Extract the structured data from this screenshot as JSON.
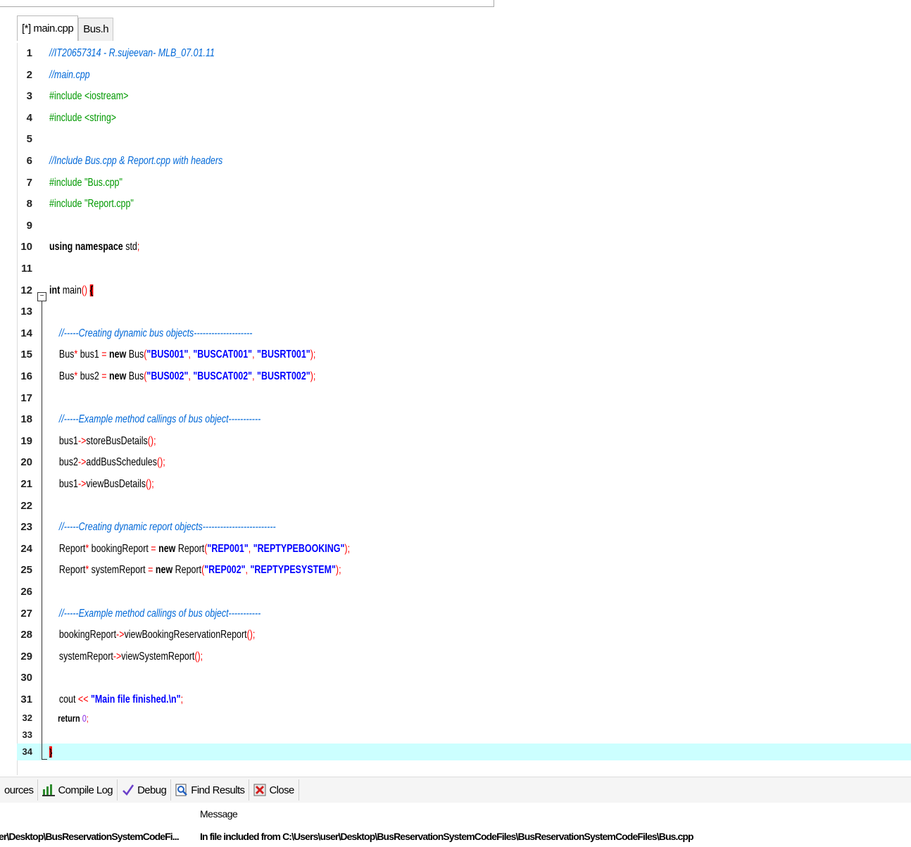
{
  "tabs": [
    {
      "label": "[*] main.cpp",
      "active": true
    },
    {
      "label": "Bus.h",
      "active": false
    }
  ],
  "editor": {
    "active_line": 34,
    "lines": [
      {
        "n": "1",
        "html": "<span class=\"cmt\">//IT20657314 - R.sujeevan- MLB_07.01.11</span>"
      },
      {
        "n": "2",
        "html": "<span class=\"cmt\">//main.cpp</span>"
      },
      {
        "n": "3",
        "html": "<span class=\"pp\">#include &lt;iostream&gt;</span>"
      },
      {
        "n": "4",
        "html": "<span class=\"pp\">#include &lt;string&gt;</span>"
      },
      {
        "n": "5",
        "html": ""
      },
      {
        "n": "6",
        "html": "<span class=\"cmt\">//Include Bus.cpp &amp; Report.cpp with headers</span>"
      },
      {
        "n": "7",
        "html": "<span class=\"pp\">#include \"Bus.cpp\"</span>"
      },
      {
        "n": "8",
        "html": "<span class=\"pp\">#include \"Report.cpp\"</span>"
      },
      {
        "n": "9",
        "html": ""
      },
      {
        "n": "10",
        "html": "<span class=\"kw\">using namespace</span> std<span class=\"op\">;</span>"
      },
      {
        "n": "11",
        "html": ""
      },
      {
        "n": "12",
        "html": "<span class=\"kw\">int</span> main<span class=\"op\">()</span> <span class=\"brace-hl\">{</span>"
      },
      {
        "n": "13",
        "html": ""
      },
      {
        "n": "14",
        "html": "    <span class=\"cmt\">//-----Creating dynamic bus objects--------------------</span>"
      },
      {
        "n": "15",
        "html": "    Bus<span class=\"op\">*</span> bus1 <span class=\"op\">=</span> <span class=\"kw\">new</span> Bus<span class=\"op\">(</span><span class=\"str\">\"BUS001\"</span><span class=\"op\">,</span> <span class=\"str\">\"BUSCAT001\"</span><span class=\"op\">,</span> <span class=\"str\">\"BUSRT001\"</span><span class=\"op\">);</span>"
      },
      {
        "n": "16",
        "html": "    Bus<span class=\"op\">*</span> bus2 <span class=\"op\">=</span> <span class=\"kw\">new</span> Bus<span class=\"op\">(</span><span class=\"str\">\"BUS002\"</span><span class=\"op\">,</span> <span class=\"str\">\"BUSCAT002\"</span><span class=\"op\">,</span> <span class=\"str\">\"BUSRT002\"</span><span class=\"op\">);</span>"
      },
      {
        "n": "17",
        "html": ""
      },
      {
        "n": "18",
        "html": "    <span class=\"cmt\">//-----Example method callings of bus object-----------</span>"
      },
      {
        "n": "19",
        "html": "    bus1<span class=\"op\">-&gt;</span>storeBusDetails<span class=\"op\">();</span>"
      },
      {
        "n": "20",
        "html": "    bus2<span class=\"op\">-&gt;</span>addBusSchedules<span class=\"op\">();</span>"
      },
      {
        "n": "21",
        "html": "    bus1<span class=\"op\">-&gt;</span>viewBusDetails<span class=\"op\">();</span>"
      },
      {
        "n": "22",
        "html": ""
      },
      {
        "n": "23",
        "html": "    <span class=\"cmt\">//-----Creating dynamic report objects-------------------------</span>"
      },
      {
        "n": "24",
        "html": "    Report<span class=\"op\">*</span> bookingReport <span class=\"op\">=</span> <span class=\"kw\">new</span> Report<span class=\"op\">(</span><span class=\"str\">\"REP001\"</span><span class=\"op\">,</span> <span class=\"str\">\"REPTYPEBOOKING\"</span><span class=\"op\">);</span>"
      },
      {
        "n": "25",
        "html": "    Report<span class=\"op\">*</span> systemReport <span class=\"op\">=</span> <span class=\"kw\">new</span> Report<span class=\"op\">(</span><span class=\"str\">\"REP002\"</span><span class=\"op\">,</span> <span class=\"str\">\"REPTYPESYSTEM\"</span><span class=\"op\">);</span>"
      },
      {
        "n": "26",
        "html": ""
      },
      {
        "n": "27",
        "html": "    <span class=\"cmt\">//-----Example method callings of bus object-----------</span>"
      },
      {
        "n": "28",
        "html": "    bookingReport<span class=\"op\">-&gt;</span>viewBookingReservationReport<span class=\"op\">();</span>"
      },
      {
        "n": "29",
        "html": "    systemReport<span class=\"op\">-&gt;</span>viewSystemReport<span class=\"op\">();</span>"
      },
      {
        "n": "30",
        "html": ""
      },
      {
        "n": "31",
        "html": "    cout <span class=\"op\">&lt;&lt;</span> <span class=\"str\">\"Main file finished.\\n\"</span><span class=\"op\">;</span>"
      },
      {
        "n": "32",
        "html": "    <span class=\"kw\">return</span> <span class=\"num\">0</span><span class=\"op\">;</span>"
      },
      {
        "n": "33",
        "html": ""
      },
      {
        "n": "34",
        "html": "<span class=\"brace-hl\">}</span>"
      }
    ]
  },
  "bottom_tabs": [
    {
      "label": "ources",
      "icon": "sources-icon"
    },
    {
      "label": "Compile Log",
      "icon": "compile-log-icon"
    },
    {
      "label": "Debug",
      "icon": "debug-check-icon"
    },
    {
      "label": "Find Results",
      "icon": "find-results-icon"
    },
    {
      "label": "Close",
      "icon": "close-panel-icon"
    }
  ],
  "messages": {
    "header": "Message",
    "rows": [
      {
        "file": "er\\Desktop\\BusReservationSystemCodeFi...",
        "message": "In file included from C:\\Users\\user\\Desktop\\BusReservationSystemCodeFiles\\BusReservationSystemCodeFiles\\Bus.cpp"
      }
    ]
  },
  "colors": {
    "comment": "#0068d8",
    "preprocessor": "#009900",
    "string": "#0000ff",
    "operator": "#ff0000",
    "number": "#8a2be2",
    "active_line_bg": "#ccffff",
    "brace_match_bg": "#ff0000"
  }
}
